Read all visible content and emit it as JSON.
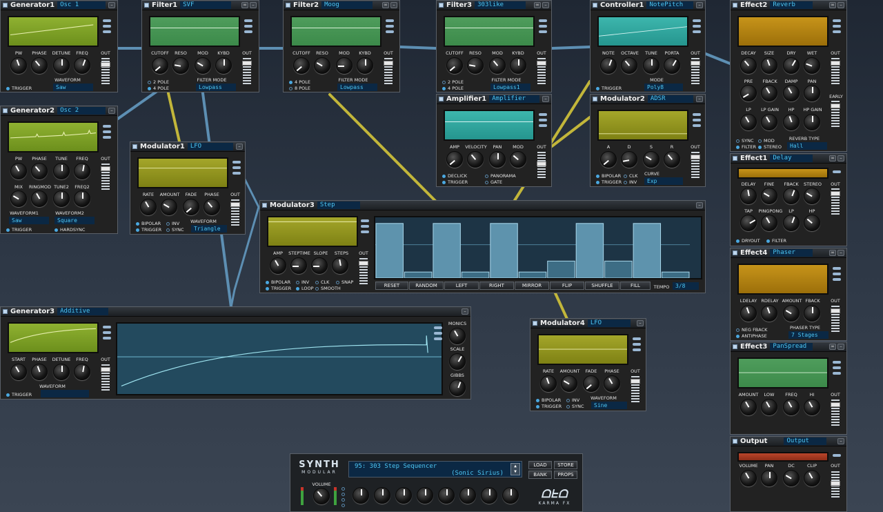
{
  "modules": {
    "gen1": {
      "title": "Generator1",
      "name": "Osc 1",
      "knobs": [
        "PW",
        "PHASE",
        "DETUNE",
        "FREQ"
      ],
      "out": "OUT",
      "waveform_label": "WAVEFORM",
      "waveform": "Saw",
      "opt": "TRIGGER"
    },
    "gen2": {
      "title": "Generator2",
      "name": "Osc 2",
      "knobs": [
        "PW",
        "PHASE",
        "TUNE",
        "FREQ"
      ],
      "knobs2": [
        "MIX",
        "RINGMOD",
        "TUNE2",
        "FREQ2"
      ],
      "out": "OUT",
      "wf1_label": "WAVEFORM1",
      "wf2_label": "WAVEFORM2",
      "wf1": "Saw",
      "wf2": "Square",
      "opt1": "TRIGGER",
      "opt2": "HARDSYNC"
    },
    "gen3": {
      "title": "Generator3",
      "name": "Additive",
      "knobs": [
        "START",
        "PHASE",
        "DETUNE",
        "FREQ"
      ],
      "out": "OUT",
      "waveform_label": "WAVEFORM",
      "waveform": "",
      "opt": "TRIGGER",
      "right": [
        "MONICS",
        "SCALE",
        "GIBBS"
      ]
    },
    "filter1": {
      "title": "Filter1",
      "name": "SVF",
      "knobs": [
        "CUTOFF",
        "RESO",
        "MOD",
        "KYBD"
      ],
      "out": "OUT",
      "opt1": "2  POLE",
      "opt2": "4  POLE",
      "mode_label": "FILTER  MODE",
      "mode": "Lowpass"
    },
    "filter2": {
      "title": "Filter2",
      "name": "Moog",
      "knobs": [
        "CUTOFF",
        "RESO",
        "MOD",
        "KYBD"
      ],
      "out": "OUT",
      "opt1": "4  POLE",
      "opt2": "8  POLE",
      "mode_label": "FILTER  MODE",
      "mode": "Lowpass"
    },
    "filter3": {
      "title": "Filter3",
      "name": "303like",
      "knobs": [
        "CUTOFF",
        "RESO",
        "MOD",
        "KYBD"
      ],
      "out": "OUT",
      "opt1": "2  POLE",
      "opt2": "4  POLE",
      "mode_label": "FILTER  MODE",
      "mode": "Lowpass1"
    },
    "ctrl1": {
      "title": "Controller1",
      "name": "NotePitch",
      "knobs": [
        "NOTE",
        "OCTAVE",
        "TUNE",
        "PORTA"
      ],
      "out": "OUT",
      "opt": "TRIGGER",
      "mode_label": "MODE",
      "mode": "Poly8"
    },
    "amp1": {
      "title": "Amplifier1",
      "name": "Amplifier",
      "knobs": [
        "AMP",
        "VELOCITY",
        "PAN",
        "MOD"
      ],
      "out": "OUT",
      "opts": [
        "DECLICK",
        "PANORAMA",
        "TRIGGER",
        "GATE"
      ]
    },
    "mod1": {
      "title": "Modulator1",
      "name": "LFO",
      "knobs": [
        "RATE",
        "AMOUNT",
        "FADE",
        "PHASE"
      ],
      "out": "OUT",
      "opts": [
        "BIPOLAR",
        "INV",
        "TRIGGER",
        "SYNC"
      ],
      "waveform_label": "WAVEFORM",
      "waveform": "Triangle"
    },
    "mod2": {
      "title": "Modulator2",
      "name": "ADSR",
      "knobs": [
        "A",
        "D",
        "S",
        "R"
      ],
      "out": "OUT",
      "opts": [
        "BIPOLAR",
        "CLK",
        "TRIGGER",
        "INV"
      ],
      "curve_label": "CURVE",
      "curve": "Exp"
    },
    "mod3": {
      "title": "Modulator3",
      "name": "Step",
      "knobs": [
        "AMP",
        "STEPTIME",
        "SLOPE",
        "STEPS"
      ],
      "out": "OUT",
      "opts": [
        "BIPOLAR",
        "INV",
        "CLK",
        "SNAP",
        "TRIGGER",
        "LOOP",
        "SMOOTH"
      ],
      "buttons": [
        "RESET",
        "RANDOM",
        "LEFT",
        "RIGHT",
        "MIRROR",
        "FLIP",
        "SHUFFLE",
        "FILL"
      ],
      "tempo_label": "TEMPO",
      "tempo": "3/8",
      "steps": [
        0.9,
        0.1,
        0.9,
        0.1,
        0.9,
        0.1,
        0.28,
        0.9,
        0.28,
        0.9,
        0.1
      ]
    },
    "mod4": {
      "title": "Modulator4",
      "name": "LFO",
      "knobs": [
        "RATE",
        "AMOUNT",
        "FADE",
        "PHASE"
      ],
      "out": "OUT",
      "opts": [
        "BIPOLAR",
        "INV",
        "TRIGGER",
        "SYNC"
      ],
      "waveform_label": "WAVEFORM",
      "waveform": "Sine"
    },
    "eff2": {
      "title": "Effect2",
      "name": "Reverb",
      "knobs": [
        "DECAY",
        "SIZE",
        "DRY",
        "WET"
      ],
      "knobs2": [
        "PRE",
        "FBACK",
        "DAMP",
        "PAN"
      ],
      "knobs3": [
        "LP",
        "LP GAIN",
        "HP",
        "HP GAIN"
      ],
      "out": "OUT",
      "early": "EARLY",
      "opts": [
        "SYNC",
        "MOD",
        "FILTER",
        "STEREO"
      ],
      "type_label": "REVERB  TYPE",
      "type": "Hall"
    },
    "eff1": {
      "title": "Effect1",
      "name": "Delay",
      "knobs": [
        "DELAY",
        "FINE",
        "FBACK",
        "STEREO"
      ],
      "knobs2": [
        "TAP",
        "PINGPONG",
        "LP",
        "HP"
      ],
      "out": "OUT",
      "opts": [
        "DRYOUT",
        "FILTER"
      ]
    },
    "eff4": {
      "title": "Effect4",
      "name": "Phaser",
      "knobs": [
        "LDELAY",
        "RDELAY",
        "AMOUNT",
        "FBACK"
      ],
      "out": "OUT",
      "opts": [
        "NEG  FBACK",
        "ANTIPHASE"
      ],
      "type_label": "PHASER  TYPE",
      "type": "7 Stages"
    },
    "eff3": {
      "title": "Effect3",
      "name": "PanSpread",
      "knobs": [
        "AMOUNT",
        "LOW",
        "FREQ",
        "HI"
      ],
      "out": "OUT"
    },
    "output": {
      "title": "Output",
      "name": "Output",
      "knobs": [
        "VOLUME",
        "PAN",
        "DC",
        "CLIP"
      ],
      "out": "OUT"
    }
  },
  "synth": {
    "logo": "SYNTH",
    "logo_sub": "MODULAR",
    "patch": "95: 303 Step Sequencer",
    "author": "(Sonic Sirius)",
    "buttons": [
      "LOAD",
      "STORE",
      "BANK",
      "PROPS"
    ],
    "volume_label": "VOLUME",
    "brand": "KARMA FX"
  }
}
